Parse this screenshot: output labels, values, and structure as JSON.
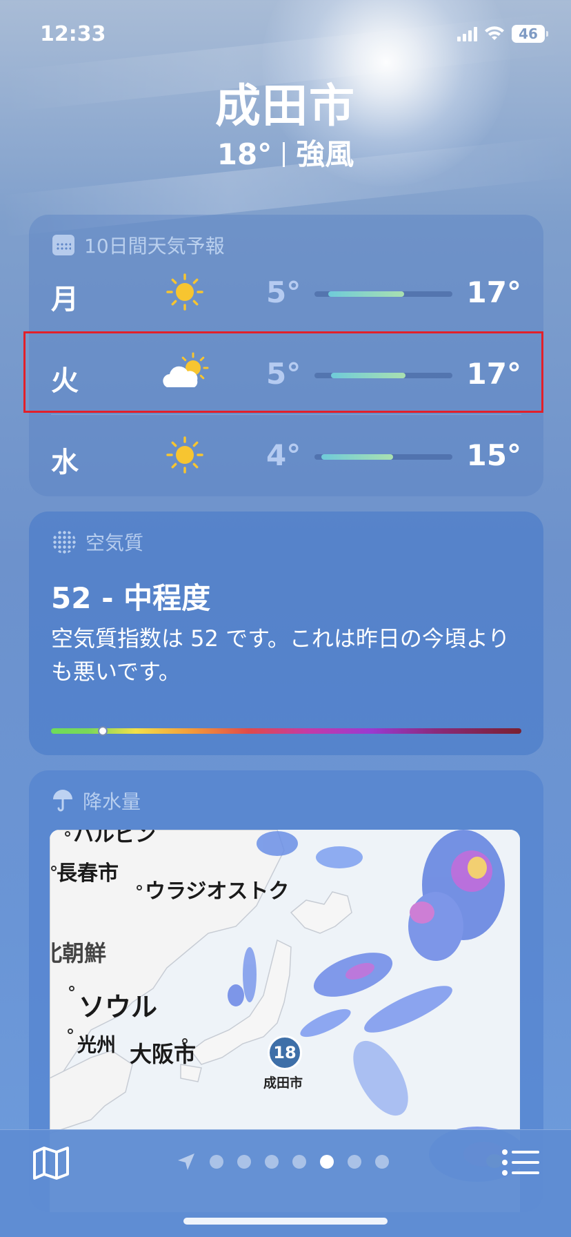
{
  "status_bar": {
    "time": "12:33",
    "battery": "46"
  },
  "header": {
    "city": "成田市",
    "temperature": "18°",
    "condition": "強風"
  },
  "forecast": {
    "title": "10日間天気予報",
    "rows": [
      {
        "day": "月",
        "icon": "sun-icon",
        "low": "5°",
        "high": "17°",
        "range_start": 0.1,
        "range_end": 0.65
      },
      {
        "day": "火",
        "icon": "partly-cloudy-icon",
        "low": "5°",
        "high": "17°",
        "range_start": 0.12,
        "range_end": 0.66
      },
      {
        "day": "水",
        "icon": "sun-icon",
        "low": "4°",
        "high": "15°",
        "range_start": 0.05,
        "range_end": 0.57
      }
    ]
  },
  "air_quality": {
    "title": "空気質",
    "value": "52 - 中程度",
    "description": "空気質指数は 52 です。これは昨日の今頃よりも悪いです。",
    "level": 0.11
  },
  "precipitation": {
    "title": "降水量",
    "map_labels": {
      "harbin": "ハルビン",
      "changchun": "長春市",
      "vladivostok": "ウラジオストク",
      "north_korea": "北朝鮮",
      "seoul": "ソウル",
      "gwangju": "光州",
      "osaka": "大阪市",
      "narita": "成田市"
    },
    "pin_temperature": "18"
  },
  "bottom_bar": {
    "page_count": 6,
    "active_page": 4
  },
  "colors": {
    "accent_red": "#e2202a",
    "sun": "#f7c530"
  }
}
